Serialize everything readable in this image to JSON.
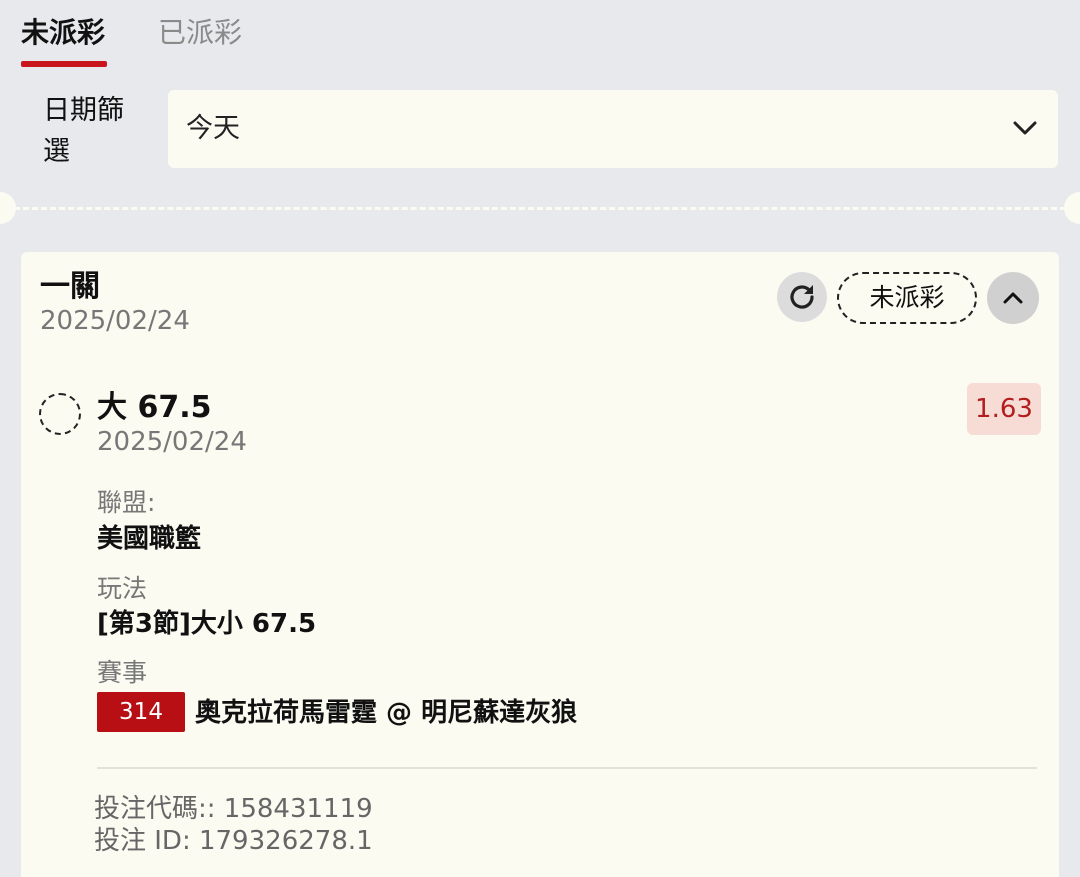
{
  "tabs": [
    {
      "label": "未派彩",
      "active": true
    },
    {
      "label": "已派彩",
      "active": false
    }
  ],
  "filter": {
    "label": "日期篩選",
    "selected": "今天"
  },
  "card": {
    "title": "一關",
    "date": "2025/02/24",
    "status": "未派彩",
    "selection": {
      "title": "大 67.5",
      "date": "2025/02/24",
      "odds": "1.63"
    },
    "league_label": "聯盟:",
    "league_value": "美國職籃",
    "play_label": "玩法",
    "play_value": "[第3節]大小 67.5",
    "match_label": "賽事",
    "match_id": "314",
    "match_name": "奧克拉荷馬雷霆 @ 明尼蘇達灰狼",
    "bet_code": "投注代碼:: 158431119",
    "bet_id": "投注 ID: 179326278.1"
  },
  "colors": {
    "accent": "#c8161d",
    "badge_red": "#b80f14",
    "odds_bg": "#f7dcd6",
    "odds_text": "#b21d1d",
    "card_bg": "#fbfbf2",
    "page_bg": "#e8e9ec"
  },
  "icons": {
    "refresh": "refresh-icon",
    "collapse": "chevron-up-icon",
    "dropdown": "chevron-down-icon"
  }
}
